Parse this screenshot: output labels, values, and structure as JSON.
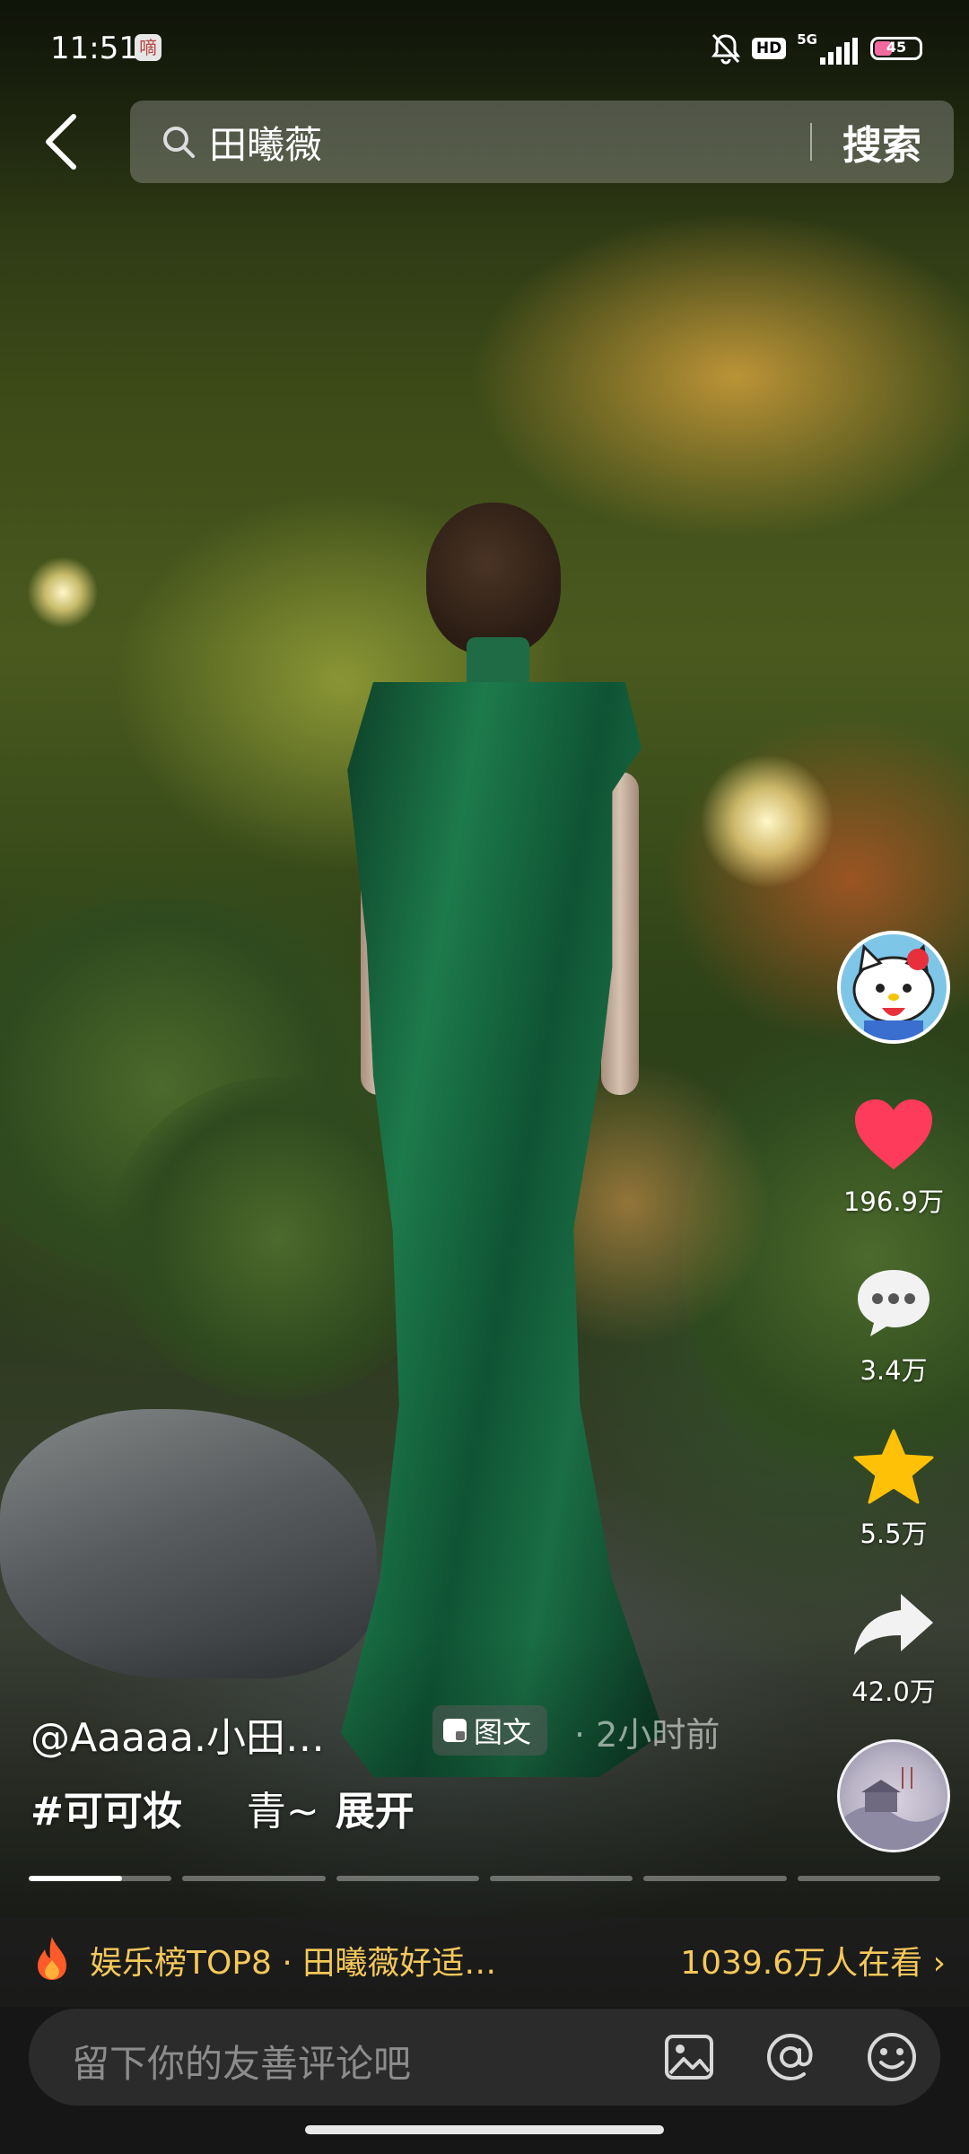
{
  "status_bar": {
    "time": "11:51",
    "app_badge": "嘀",
    "hd": "HD",
    "network": "5G",
    "battery_level": "45",
    "battery_fraction": 0.45
  },
  "search": {
    "query": "田曦薇",
    "button_label": "搜索"
  },
  "actions": {
    "likes": "196.9万",
    "comments": "3.4万",
    "favorites": "5.5万",
    "shares": "42.0万"
  },
  "post": {
    "author": "@Aaaaa.小田…",
    "type_badge": "图文",
    "time": "· 2小时前",
    "hashtag": "#可可妆",
    "caption_text": "青~",
    "expand_label": "展开",
    "image_count": 6,
    "current_image": 1
  },
  "hot_bar": {
    "title": "娱乐榜TOP8 · 田曦薇好适…",
    "viewers": "1039.6万人在看 ›"
  },
  "comment_bar": {
    "placeholder": "留下你的友善评论吧"
  },
  "colors": {
    "like_red": "#ff3b5c",
    "favorite_yellow": "#ffc107",
    "hot_text": "#f5c85a",
    "dress_green": "#1d7a4b"
  }
}
